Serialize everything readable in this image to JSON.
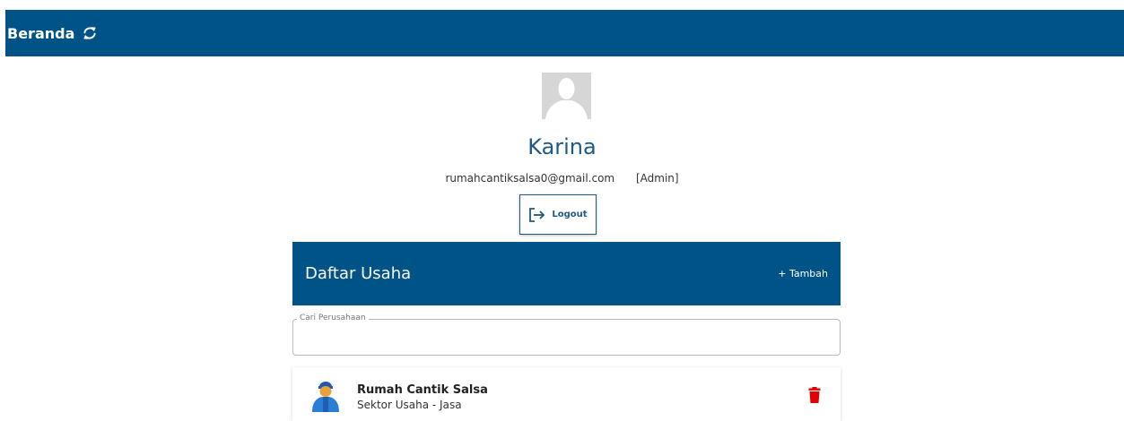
{
  "header": {
    "title": "Beranda",
    "refresh_icon": "refresh-icon"
  },
  "profile": {
    "avatar_icon": "user-avatar-placeholder",
    "name": "Karina",
    "email": "rumahcantiksalsa0@gmail.com",
    "role": "[Admin]",
    "logout_label": "Logout"
  },
  "business_list": {
    "title": "Daftar Usaha",
    "add_label": "+ Tambah",
    "search_label": "Cari Perusahaan",
    "search_value": "",
    "items": [
      {
        "name": "Rumah Cantik Salsa",
        "sector": "Sektor Usaha - Jasa",
        "icon": "worker-icon",
        "delete_icon": "trash-icon"
      }
    ]
  },
  "colors": {
    "primary": "#005386",
    "danger": "#e00000",
    "name_text": "#1e5a86"
  }
}
